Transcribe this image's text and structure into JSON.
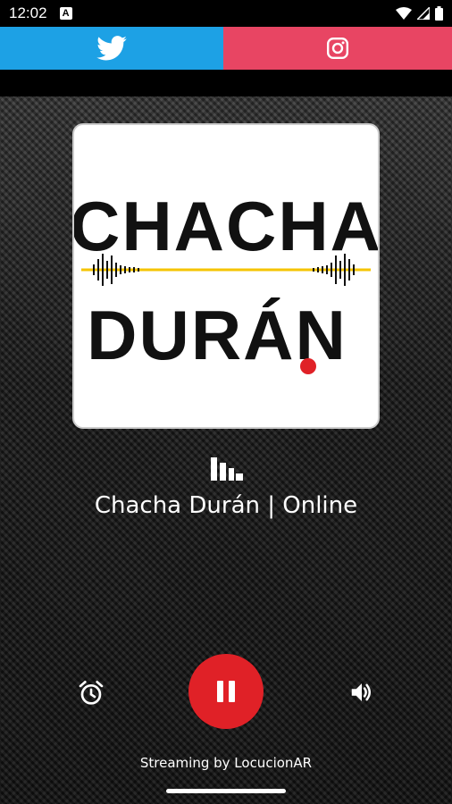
{
  "status_bar": {
    "time": "12:02",
    "notification_letter": "A",
    "icons": [
      "wifi-icon",
      "signal-icon",
      "battery-icon"
    ]
  },
  "social": {
    "twitter": {
      "icon": "twitter-icon",
      "color": "#1da1e5"
    },
    "instagram": {
      "icon": "instagram-icon",
      "color": "#e84563"
    }
  },
  "logo": {
    "line1": "CHACHA",
    "line2": "DURÁN",
    "accent_yellow": "#f5c400",
    "accent_red": "#e02127"
  },
  "station": {
    "icon": "equalizer-bars-icon",
    "name": "Chacha Durán | Online"
  },
  "controls": {
    "alarm": "alarm-clock-icon",
    "play_state": "pause-icon",
    "volume": "volume-icon",
    "button_color": "#e02127"
  },
  "footer": {
    "credit": "Streaming by LocucionAR"
  }
}
